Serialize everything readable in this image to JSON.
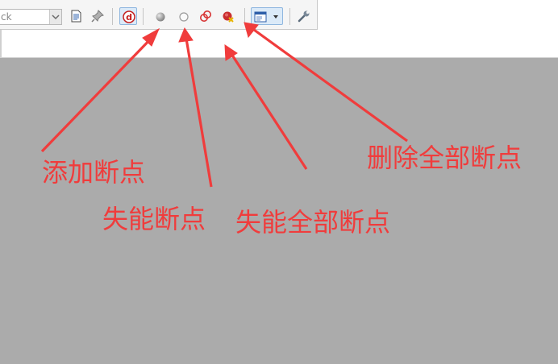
{
  "toolbar": {
    "combo_text": "ck",
    "icons": {
      "dropdown": "chevron-down-icon",
      "document": "document-icon",
      "pin": "pin-icon",
      "debug": "debug-icon",
      "add_breakpoint": "breakpoint-filled-icon",
      "disable_breakpoint": "breakpoint-hollow-icon",
      "disable_all": "breakpoints-disable-all-icon",
      "delete_all": "breakpoints-delete-all-icon",
      "window_menu": "window-menu-icon",
      "wrench": "wrench-icon"
    }
  },
  "annotations": {
    "add_breakpoint": "添加断点",
    "disable_breakpoint": "失能断点",
    "disable_all_breakpoints": "失能全部断点",
    "delete_all_breakpoints": "删除全部断点"
  },
  "colors": {
    "annotation": "#f03c3c",
    "workspace": "#ababab",
    "toolbar": "#f5f5f5",
    "pressed": "#dbeaf8"
  }
}
